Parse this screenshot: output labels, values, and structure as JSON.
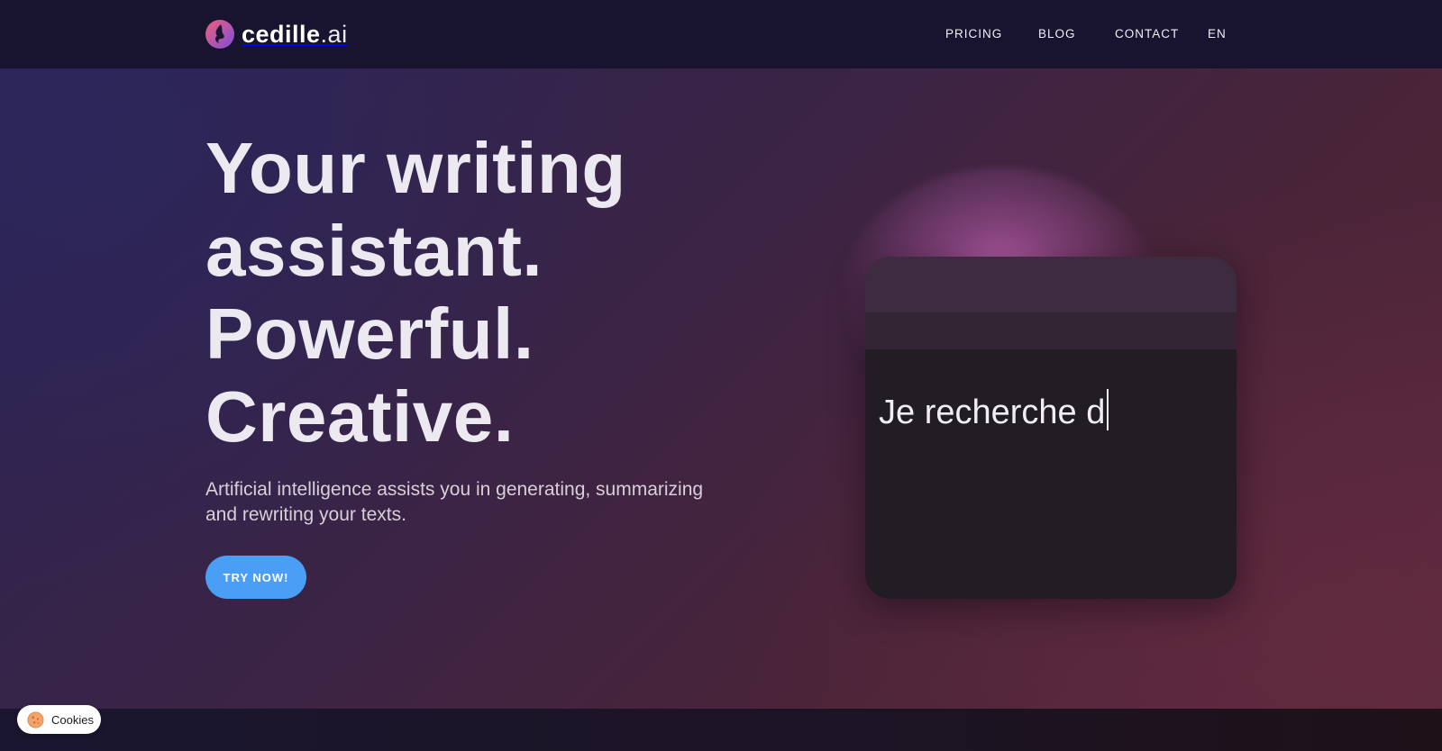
{
  "brand": {
    "name": "cedille",
    "tld": ".ai",
    "logo_icon": "flame-logo-icon"
  },
  "nav": {
    "items": [
      {
        "label": "PRICING"
      },
      {
        "label": "BLOG"
      },
      {
        "label": "CONTACT"
      }
    ],
    "language": "EN"
  },
  "hero": {
    "headline_lines": [
      "Your writing",
      "assistant.",
      "Powerful.",
      "Creative."
    ],
    "subtitle": "Artificial intelligence assists you in generating, summarizing and rewriting your texts.",
    "cta_label": "TRY NOW!"
  },
  "editor": {
    "typed_text": "Je recherche d"
  },
  "cookies": {
    "label": "Cookies",
    "icon": "cookie-icon"
  },
  "colors": {
    "header_bg": "#181430",
    "cta": "#4a9ef4",
    "editor_bg": "#221d22",
    "glow": "#d66ebe"
  }
}
